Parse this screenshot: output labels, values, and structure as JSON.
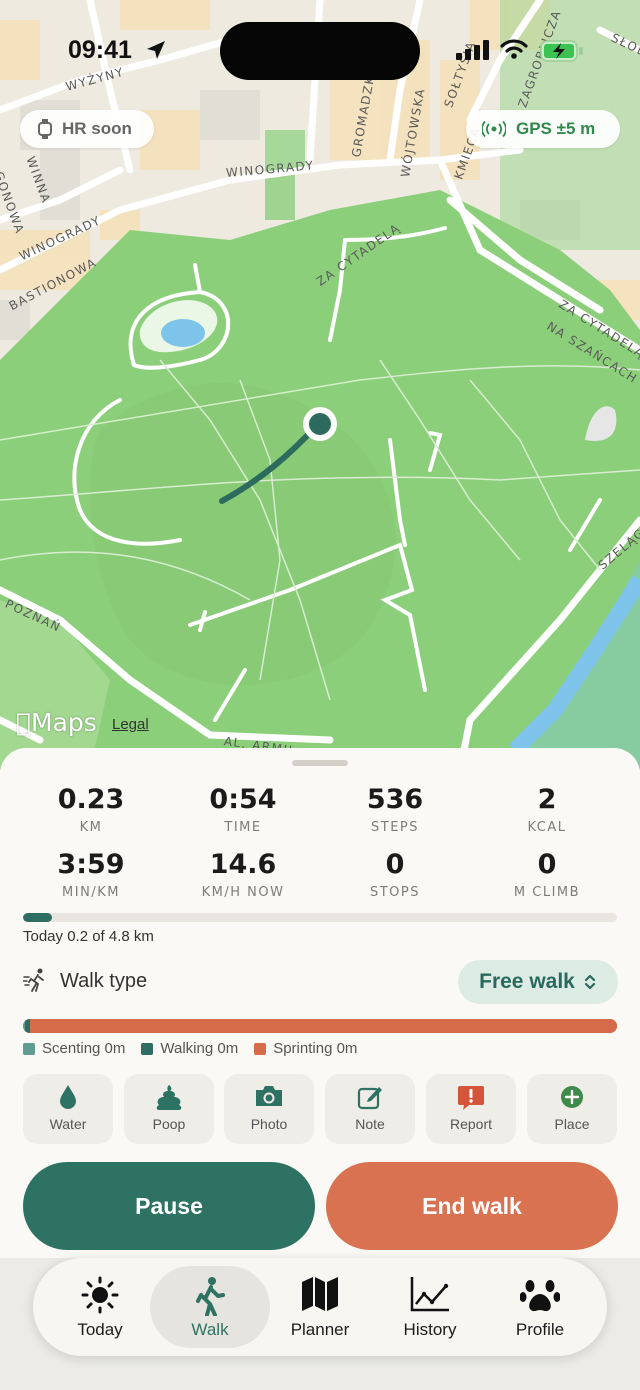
{
  "status_bar": {
    "time": "09:41"
  },
  "map": {
    "hr_pill": "HR soon",
    "gps_pill": "GPS ±5 m",
    "maps_label": "Maps",
    "legal_label": "Legal",
    "streets": [
      "WYŻYNY",
      "SOŁTYSIA",
      "ZAGROBLICZA",
      "SŁOB",
      "WINOGRADY",
      "WINOGRADY",
      "BASTIONOWA",
      "ZA CYTADELĄ",
      "ZA CYTADELĄ",
      "NA SZAŃCACH",
      "GROMADZKA",
      "WÓJTOWSKA",
      "KMIECA",
      "GONOWA",
      "WINNA",
      "SZELĄG",
      "POZNAŃ",
      "AL. ARMII"
    ]
  },
  "stats": [
    {
      "value": "0.23",
      "label": "KM"
    },
    {
      "value": "0:54",
      "label": "TIME"
    },
    {
      "value": "536",
      "label": "STEPS"
    },
    {
      "value": "2",
      "label": "KCAL"
    },
    {
      "value": "3:59",
      "label": "MIN/KM"
    },
    {
      "value": "14.6",
      "label": "KM/H NOW"
    },
    {
      "value": "0",
      "label": "STOPS"
    },
    {
      "value": "0",
      "label": "M CLIMB"
    }
  ],
  "progress": {
    "fraction": 0.048,
    "text": "Today 0.2 of 4.8 km"
  },
  "walk_type": {
    "label": "Walk type",
    "selected": "Free walk"
  },
  "mix": {
    "segments": [
      {
        "name": "Scenting",
        "fraction": 0.004,
        "color": "#5f9d92"
      },
      {
        "name": "Walking",
        "fraction": 0.008,
        "color": "#2e6e62"
      },
      {
        "name": "Sprinting",
        "fraction": 0.988,
        "color": "#d66b4a"
      }
    ],
    "legend": [
      "Scenting 0m",
      "Walking 0m",
      "Sprinting 0m"
    ]
  },
  "actions": [
    {
      "icon": "water-drop-icon",
      "label": "Water"
    },
    {
      "icon": "poop-icon",
      "label": "Poop"
    },
    {
      "icon": "camera-icon",
      "label": "Photo"
    },
    {
      "icon": "note-icon",
      "label": "Note"
    },
    {
      "icon": "report-icon",
      "label": "Report"
    },
    {
      "icon": "add-place-icon",
      "label": "Place"
    }
  ],
  "buttons": {
    "pause": "Pause",
    "end": "End walk"
  },
  "tabs": [
    {
      "icon": "sun-icon",
      "label": "Today"
    },
    {
      "icon": "walker-icon",
      "label": "Walk",
      "active": true
    },
    {
      "icon": "map-icon",
      "label": "Planner"
    },
    {
      "icon": "chart-icon",
      "label": "History"
    },
    {
      "icon": "paw-icon",
      "label": "Profile"
    }
  ],
  "colors": {
    "accent": "#2e7263",
    "danger": "#d97250",
    "park": "#8ccf7a",
    "gps": "#2f8a4c"
  }
}
